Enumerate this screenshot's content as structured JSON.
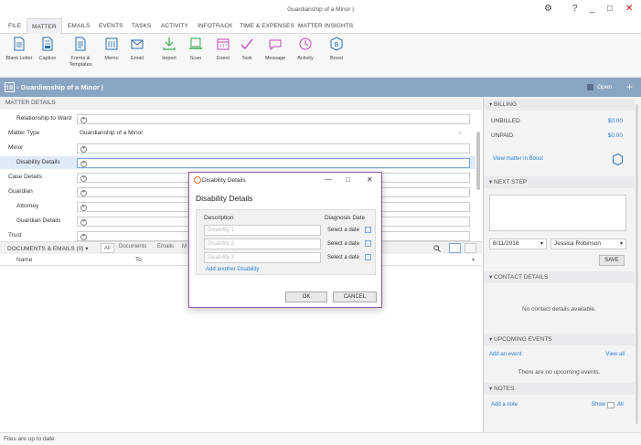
{
  "window": {
    "title": "Guardianship of a Minor |",
    "controls": {
      "settings": "⚙",
      "help": "?",
      "minimize": "_",
      "maximize": "□",
      "close": "✕"
    }
  },
  "menu_tabs": [
    "FILE",
    "MATTER",
    "EMAILS",
    "EVENTS",
    "TASKS",
    "ACTIVITY",
    "INFOTRACK",
    "TIME & EXPENSES",
    "MATTER INSIGHTS"
  ],
  "ribbon": [
    {
      "label": "Blank Letter",
      "icon": "blank-letter-icon"
    },
    {
      "label": "Caption",
      "icon": "caption-icon"
    },
    {
      "label": "Forms & Templates",
      "icon": "forms-templates-icon"
    },
    {
      "label": "Memo",
      "icon": "memo-icon"
    },
    {
      "label": "Email",
      "icon": "email-icon"
    },
    {
      "label": "Import",
      "icon": "import-icon"
    },
    {
      "label": "Scan",
      "icon": "scan-icon"
    },
    {
      "label": "Event",
      "icon": "event-icon"
    },
    {
      "label": "Task",
      "icon": "task-icon"
    },
    {
      "label": "Message",
      "icon": "message-icon"
    },
    {
      "label": "Activity",
      "icon": "activity-icon"
    },
    {
      "label": "Boost",
      "icon": "boost-icon"
    }
  ],
  "header": {
    "title": "- Guardianship of a Minor |",
    "status": "Open",
    "add": "+"
  },
  "matter_details": {
    "heading": "MATTER DETAILS",
    "rows": [
      {
        "label": "Relationship to Ward",
        "value": ""
      },
      {
        "label": "Matter Type",
        "value": "Guardianship of a Minor"
      },
      {
        "label": "Minor",
        "value": ""
      },
      {
        "label": "Disability Details",
        "value": ""
      },
      {
        "label": "Case Details",
        "value": ""
      },
      {
        "label": "Guardian",
        "value": ""
      },
      {
        "label": "Attorney",
        "value": ""
      },
      {
        "label": "Guardian Details",
        "value": ""
      },
      {
        "label": "Trust",
        "value": ""
      }
    ]
  },
  "documents": {
    "heading": "DOCUMENTS & EMAILS (0) ▾",
    "tabs": [
      "All",
      "Documents",
      "Emails",
      "M"
    ],
    "columns": [
      "Name",
      "To"
    ]
  },
  "status_bar": {
    "text": "Files are up to date"
  },
  "billing": {
    "heading": "BILLING",
    "unbilled_label": "UNBILLED",
    "unbilled_value": "$0.00",
    "unpaid_label": "UNPAID",
    "unpaid_value": "$0.00",
    "link": "View matter in Boost"
  },
  "next_step": {
    "heading": "NEXT STEP",
    "date": "6/11/2018",
    "person": "Jessica Robinson",
    "save": "SAVE"
  },
  "contact_details": {
    "heading": "CONTACT DETAILS",
    "empty": "No contact details available."
  },
  "upcoming_events": {
    "heading": "UPCOMING EVENTS",
    "add": "Add an event",
    "view_all": "View all",
    "empty": "There are no upcoming events."
  },
  "notes": {
    "heading": "NOTES",
    "add": "Add a note",
    "show": "Show",
    "all": "All"
  },
  "dialog": {
    "title": "Disability Details",
    "heading": "Disability Details",
    "col_description": "Description",
    "col_date": "Diagnosis Date",
    "rows": [
      {
        "placeholder": "Disability 1",
        "date": "Select a date"
      },
      {
        "placeholder": "Disability 2",
        "date": "Select a date"
      },
      {
        "placeholder": "Disability 3",
        "date": "Select a date"
      }
    ],
    "add_link": "Add another Disability",
    "ok": "OK",
    "cancel": "CANCEL",
    "controls": {
      "minimize": "—",
      "maximize": "□",
      "close": "✕"
    }
  },
  "colors": {
    "header_bg": "#8aa4c4",
    "link": "#2a7fd4",
    "dialog_border": "#8e5aa0",
    "close_red": "#cc0000"
  }
}
